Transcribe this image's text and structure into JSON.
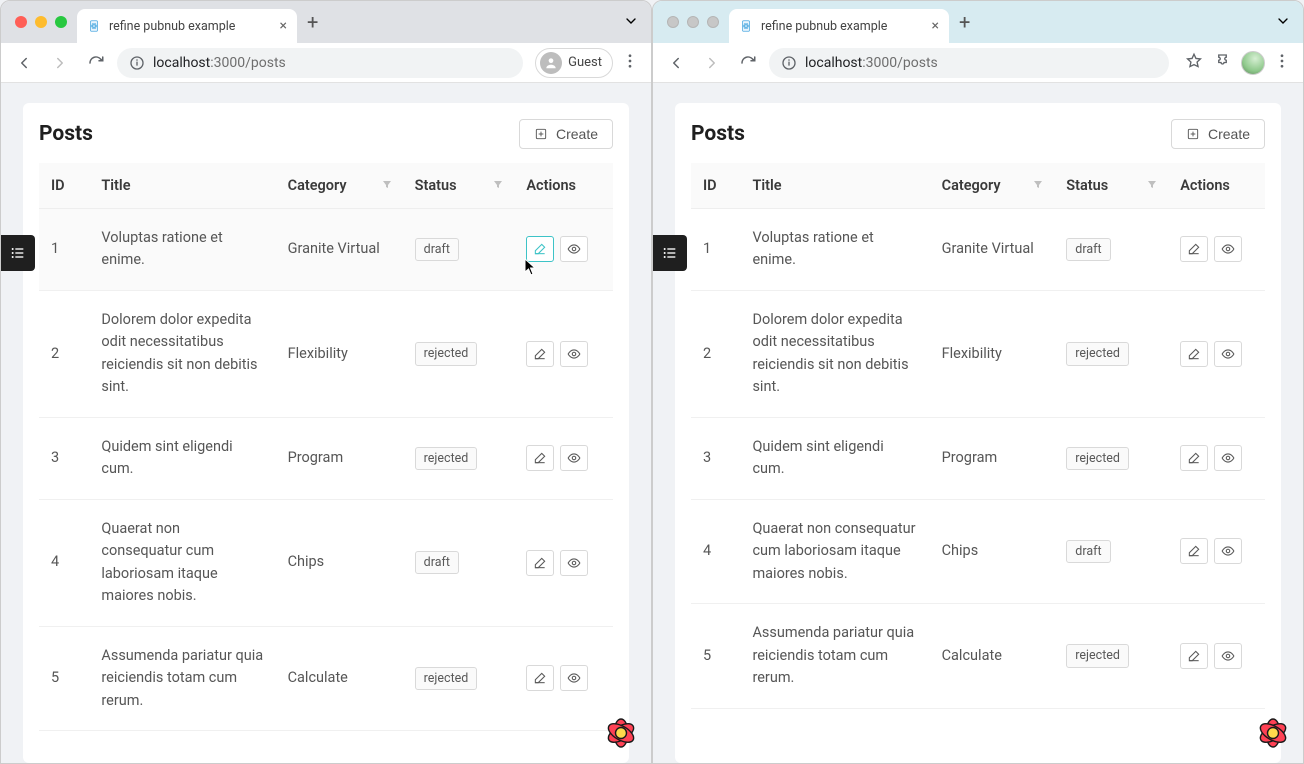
{
  "window_left": {
    "tab_title": "refine pubnub example",
    "url_host": "localhost",
    "url_port": ":3000",
    "url_path": "/posts",
    "guest_label": "Guest"
  },
  "window_right": {
    "tab_title": "refine pubnub example",
    "url_host": "localhost",
    "url_port": ":3000",
    "url_path": "/posts"
  },
  "page": {
    "title": "Posts",
    "create_label": "Create",
    "columns": {
      "id": "ID",
      "title": "Title",
      "category": "Category",
      "status": "Status",
      "actions": "Actions"
    },
    "rows": [
      {
        "id": "1",
        "title": "Voluptas ratione et enime.",
        "category": "Granite Virtual",
        "status": "draft"
      },
      {
        "id": "2",
        "title": "Dolorem dolor expedita odit necessitatibus reiciendis sit non debitis sint.",
        "category": "Flexibility",
        "status": "rejected"
      },
      {
        "id": "3",
        "title": "Quidem sint eligendi cum.",
        "category": "Program",
        "status": "rejected"
      },
      {
        "id": "4",
        "title": "Quaerat non consequatur cum laboriosam itaque maiores nobis.",
        "category": "Chips",
        "status": "draft"
      },
      {
        "id": "5",
        "title": "Assumenda pariatur quia reiciendis totam cum rerum.",
        "category": "Calculate",
        "status": "rejected"
      }
    ]
  }
}
